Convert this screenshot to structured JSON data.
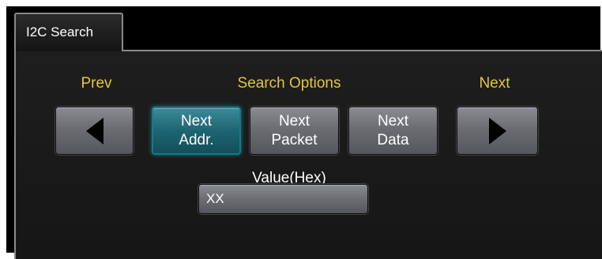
{
  "tab": {
    "label": "I2C Search"
  },
  "labels": {
    "prev": "Prev",
    "search_options": "Search Options",
    "next": "Next",
    "value_hex": "Value(Hex)"
  },
  "search_options": [
    {
      "label": "Next\nAddr.",
      "selected": true
    },
    {
      "label": "Next\nPacket",
      "selected": false
    },
    {
      "label": "Next\nData",
      "selected": false
    }
  ],
  "value_field": {
    "value": "XX"
  },
  "colors": {
    "label_yellow": "#e2c63e",
    "selected_teal": "#1d6572",
    "button_gray": "#6b6d73"
  },
  "icons": {
    "prev": "triangle-left",
    "next": "triangle-right"
  }
}
